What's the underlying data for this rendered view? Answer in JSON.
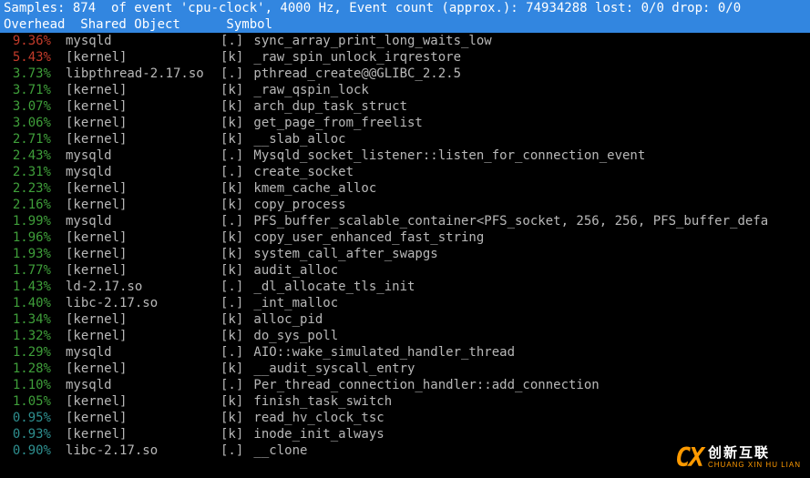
{
  "header": {
    "line1": "Samples: 874  of event 'cpu-clock', 4000 Hz, Event count (approx.): 74934288 lost: 0/0 drop: 0/0",
    "line2": "Overhead  Shared Object      Symbol"
  },
  "rows": [
    {
      "pct": "9.36%",
      "cls": "c-red",
      "obj": "mysqld",
      "tag": "[.]",
      "sym": "sync_array_print_long_waits_low"
    },
    {
      "pct": "5.43%",
      "cls": "c-red",
      "obj": "[kernel]",
      "tag": "[k]",
      "sym": "_raw_spin_unlock_irqrestore"
    },
    {
      "pct": "3.73%",
      "cls": "c-green",
      "obj": "libpthread-2.17.so",
      "tag": "[.]",
      "sym": "pthread_create@@GLIBC_2.2.5"
    },
    {
      "pct": "3.71%",
      "cls": "c-green",
      "obj": "[kernel]",
      "tag": "[k]",
      "sym": "_raw_qspin_lock"
    },
    {
      "pct": "3.07%",
      "cls": "c-green",
      "obj": "[kernel]",
      "tag": "[k]",
      "sym": "arch_dup_task_struct"
    },
    {
      "pct": "3.06%",
      "cls": "c-green",
      "obj": "[kernel]",
      "tag": "[k]",
      "sym": "get_page_from_freelist"
    },
    {
      "pct": "2.71%",
      "cls": "c-green",
      "obj": "[kernel]",
      "tag": "[k]",
      "sym": "__slab_alloc"
    },
    {
      "pct": "2.43%",
      "cls": "c-green",
      "obj": "mysqld",
      "tag": "[.]",
      "sym": "Mysqld_socket_listener::listen_for_connection_event"
    },
    {
      "pct": "2.31%",
      "cls": "c-green",
      "obj": "mysqld",
      "tag": "[.]",
      "sym": "create_socket"
    },
    {
      "pct": "2.23%",
      "cls": "c-green",
      "obj": "[kernel]",
      "tag": "[k]",
      "sym": "kmem_cache_alloc"
    },
    {
      "pct": "2.16%",
      "cls": "c-green",
      "obj": "[kernel]",
      "tag": "[k]",
      "sym": "copy_process"
    },
    {
      "pct": "1.99%",
      "cls": "c-green",
      "obj": "mysqld",
      "tag": "[.]",
      "sym": "PFS_buffer_scalable_container<PFS_socket, 256, 256, PFS_buffer_defa"
    },
    {
      "pct": "1.96%",
      "cls": "c-green",
      "obj": "[kernel]",
      "tag": "[k]",
      "sym": "copy_user_enhanced_fast_string"
    },
    {
      "pct": "1.93%",
      "cls": "c-green",
      "obj": "[kernel]",
      "tag": "[k]",
      "sym": "system_call_after_swapgs"
    },
    {
      "pct": "1.77%",
      "cls": "c-green",
      "obj": "[kernel]",
      "tag": "[k]",
      "sym": "audit_alloc"
    },
    {
      "pct": "1.43%",
      "cls": "c-green",
      "obj": "ld-2.17.so",
      "tag": "[.]",
      "sym": "_dl_allocate_tls_init"
    },
    {
      "pct": "1.40%",
      "cls": "c-green",
      "obj": "libc-2.17.so",
      "tag": "[.]",
      "sym": "_int_malloc"
    },
    {
      "pct": "1.34%",
      "cls": "c-green",
      "obj": "[kernel]",
      "tag": "[k]",
      "sym": "alloc_pid"
    },
    {
      "pct": "1.32%",
      "cls": "c-green",
      "obj": "[kernel]",
      "tag": "[k]",
      "sym": "do_sys_poll"
    },
    {
      "pct": "1.29%",
      "cls": "c-green",
      "obj": "mysqld",
      "tag": "[.]",
      "sym": "AIO::wake_simulated_handler_thread"
    },
    {
      "pct": "1.28%",
      "cls": "c-green",
      "obj": "[kernel]",
      "tag": "[k]",
      "sym": "__audit_syscall_entry"
    },
    {
      "pct": "1.10%",
      "cls": "c-green",
      "obj": "mysqld",
      "tag": "[.]",
      "sym": "Per_thread_connection_handler::add_connection"
    },
    {
      "pct": "1.05%",
      "cls": "c-green",
      "obj": "[kernel]",
      "tag": "[k]",
      "sym": "finish_task_switch"
    },
    {
      "pct": "0.95%",
      "cls": "c-teal",
      "obj": "[kernel]",
      "tag": "[k]",
      "sym": "read_hv_clock_tsc"
    },
    {
      "pct": "0.93%",
      "cls": "c-teal",
      "obj": "[kernel]",
      "tag": "[k]",
      "sym": "inode_init_always"
    },
    {
      "pct": "0.90%",
      "cls": "c-teal",
      "obj": "libc-2.17.so",
      "tag": "[.]",
      "sym": "__clone"
    }
  ],
  "watermark": {
    "logo": "CX",
    "name": "创新互联",
    "py": "CHUANG XIN HU LIAN"
  }
}
